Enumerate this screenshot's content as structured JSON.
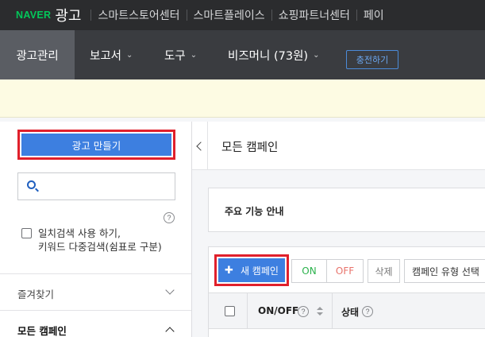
{
  "topbar": {
    "brand": "NAVER",
    "product": "광고",
    "links": [
      "스마트스토어센터",
      "스마트플레이스",
      "쇼핑파트너센터",
      "페이"
    ]
  },
  "navbar": {
    "active": "광고관리",
    "reports": "보고서",
    "tools": "도구",
    "bizmoney": "비즈머니 (73원)",
    "charge": "충전하기"
  },
  "sidebar": {
    "create_button": "광고 만들기",
    "search_placeholder": "",
    "option_line1": "일치검색 사용 하기,",
    "option_line2": "키워드 다중검색(쉼표로 구분)",
    "favorites": "즐겨찾기",
    "all_campaigns": "모든 캠페인"
  },
  "main": {
    "title": "모든 캠페인",
    "guide": "주요 기능 안내",
    "toolbar": {
      "new_campaign": "새 캠페인",
      "on": "ON",
      "off": "OFF",
      "delete": "삭제",
      "type_select": "캠페인 유형 선택"
    },
    "columns": [
      "ON/OFF",
      "상태"
    ]
  },
  "colors": {
    "accent": "#3d7fe0",
    "highlight": "#e0202b",
    "brand_green": "#03c75a",
    "on_green": "#2bb24c",
    "off_red": "#e8736b"
  }
}
